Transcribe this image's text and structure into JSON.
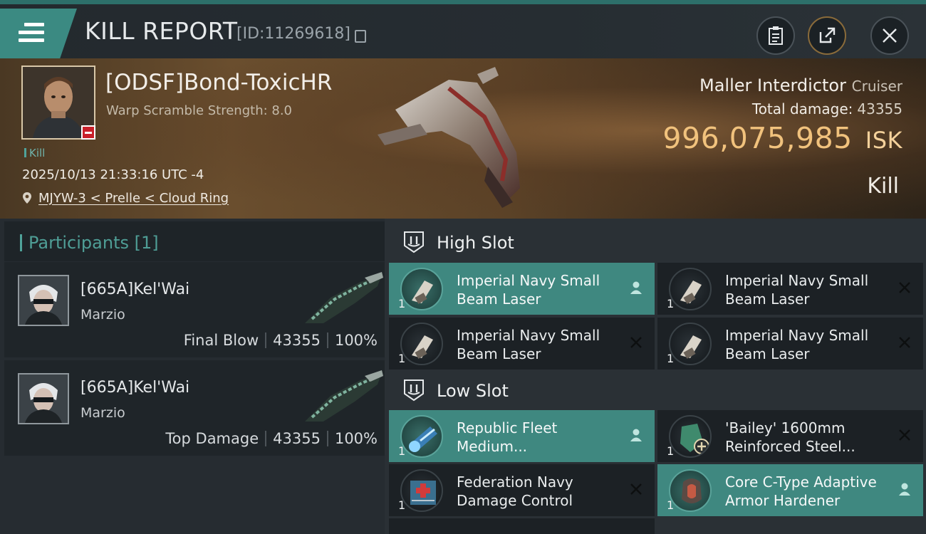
{
  "header": {
    "title": "KILL REPORT",
    "report_id": "[ID:11269618]",
    "icons": [
      "menu-icon",
      "copy-icon",
      "clipboard-icon",
      "share-icon",
      "close-icon"
    ]
  },
  "victim": {
    "name": "[ODSF]Bond-ToxicHR",
    "subtitle": "Warp Scramble Strength: 8.0",
    "tag": "Kill",
    "datetime": "2025/10/13 21:33:16 UTC -4",
    "location": "MJYW-3 < Prelle < Cloud Ring"
  },
  "ship": {
    "name": "Maller Interdictor",
    "class": "Cruiser",
    "damage_label": "Total damage:",
    "damage_value": "43355",
    "isk_value": "996,075,985",
    "isk_unit": "ISK",
    "result": "Kill"
  },
  "participants": {
    "title": "Participants",
    "count": "[1]",
    "items": [
      {
        "name": "[665A]Kel'Wai",
        "corp": "Marzio",
        "role": "Final Blow",
        "damage": "43355",
        "percent": "100%"
      },
      {
        "name": "[665A]Kel'Wai",
        "corp": "Marzio",
        "role": "Top Damage",
        "damage": "43355",
        "percent": "100%"
      }
    ]
  },
  "slots": {
    "high_label": "High Slot",
    "low_label": "Low Slot",
    "high": [
      {
        "name": "Imperial Navy Small Beam Laser",
        "qty": "1",
        "state": "fitted"
      },
      {
        "name": "Imperial Navy Small Beam Laser",
        "qty": "1",
        "state": "destroyed"
      },
      {
        "name": "Imperial Navy Small Beam Laser",
        "qty": "1",
        "state": "destroyed"
      },
      {
        "name": "Imperial Navy Small Beam Laser",
        "qty": "1",
        "state": "destroyed"
      }
    ],
    "low": [
      {
        "name": "Republic Fleet Medium...",
        "qty": "1",
        "state": "fitted"
      },
      {
        "name": "'Bailey' 1600mm Reinforced Steel...",
        "qty": "1",
        "state": "destroyed"
      },
      {
        "name": "Federation Navy Damage Control",
        "qty": "1",
        "state": "destroyed"
      },
      {
        "name": "Core C-Type Adaptive Armor Hardener",
        "qty": "1",
        "state": "fitted"
      }
    ]
  },
  "colors": {
    "accent": "#3f8880",
    "isk": "#f1c27d",
    "panel": "#1f2529"
  }
}
